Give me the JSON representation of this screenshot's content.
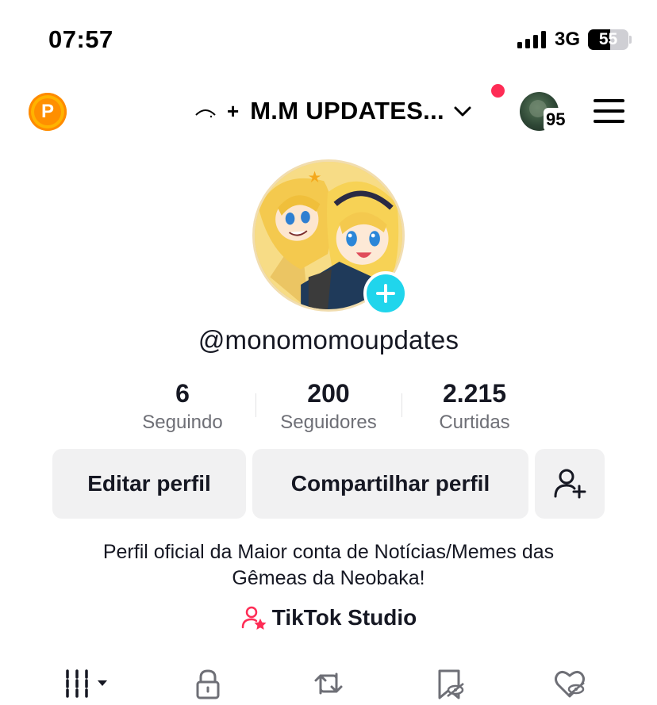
{
  "status_bar": {
    "time": "07:57",
    "network": "3G",
    "battery": "55",
    "battery_level": 0.55
  },
  "top_nav": {
    "coin_label": "P",
    "plus": "+",
    "account_name": "M.M UPDATES...",
    "friend_count": "95",
    "icons": [
      "coin-icon",
      "account-logo-icon",
      "chevron-down-icon",
      "notification-dot",
      "friend-avatar",
      "menu-icon"
    ]
  },
  "profile": {
    "username": "@monomomoupdates",
    "stats": [
      {
        "value": "6",
        "label": "Seguindo"
      },
      {
        "value": "200",
        "label": "Seguidores"
      },
      {
        "value": "2.215",
        "label": "Curtidas"
      }
    ],
    "buttons": {
      "edit": "Editar perfil",
      "share": "Compartilhar perfil"
    },
    "bio_line1": "Perfil oficial da Maior conta de Notícias/Memes das",
    "bio_line2": "Gêmeas da Neobaka!",
    "studio_label": "TikTok Studio"
  },
  "tabs": [
    {
      "icon": "grid-icon"
    },
    {
      "icon": "lock-icon"
    },
    {
      "icon": "repost-icon"
    },
    {
      "icon": "bookmark-hidden-icon"
    },
    {
      "icon": "liked-hidden-icon"
    }
  ],
  "colors": {
    "accent_red": "#fe2c55",
    "accent_cyan": "#20d5ec",
    "coin": "#ffb300",
    "text": "#161823",
    "muted": "#6e6f76",
    "button_bg": "#f1f1f2"
  }
}
